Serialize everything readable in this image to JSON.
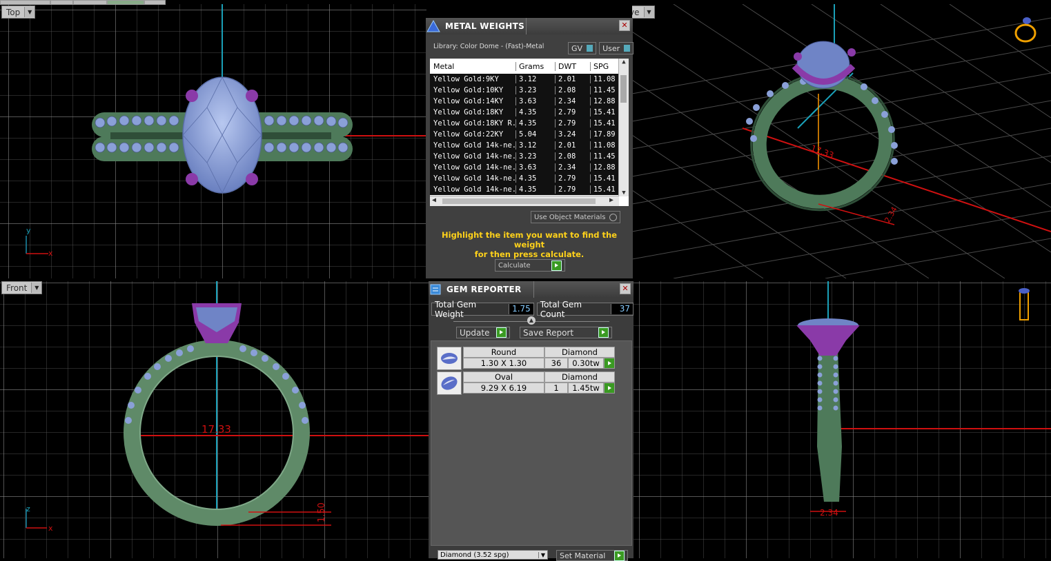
{
  "viewports": {
    "top": {
      "label": "Top"
    },
    "perspective": {
      "label": "Perspective"
    },
    "front": {
      "label": "Front"
    },
    "right": {
      "label": ""
    }
  },
  "dimensions": {
    "ring_diameter_top_persp": "17.33",
    "ring_diameter_front": "17.33",
    "persp_small": "2.34",
    "front_height": "1.50",
    "side_width": "2.34"
  },
  "axes": {
    "y": "y",
    "x": "x",
    "z": "z"
  },
  "metal_weights": {
    "title": "METAL WEIGHTS",
    "library": "Library: Color Dome - (Fast)-Metal",
    "gv_label": "GV",
    "user_label": "User",
    "columns": [
      "Metal",
      "Grams",
      "DWT",
      "SPG"
    ],
    "rows": [
      [
        "Yellow Gold:9KY",
        "3.12",
        "2.01",
        "11.08"
      ],
      [
        "Yellow Gold:10KY",
        "3.23",
        "2.08",
        "11.45"
      ],
      [
        "Yellow Gold:14KY",
        "3.63",
        "2.34",
        "12.88"
      ],
      [
        "Yellow Gold:18KY",
        "4.35",
        "2.79",
        "15.41"
      ],
      [
        "Yellow Gold:18KY R...",
        "4.35",
        "2.79",
        "15.41"
      ],
      [
        "Yellow Gold:22KY",
        "5.04",
        "3.24",
        "17.89"
      ],
      [
        "Yellow Gold 14k-ne...",
        "3.12",
        "2.01",
        "11.08"
      ],
      [
        "Yellow Gold 14k-ne...",
        "3.23",
        "2.08",
        "11.45"
      ],
      [
        "Yellow Gold 14k-ne...",
        "3.63",
        "2.34",
        "12.88"
      ],
      [
        "Yellow Gold 14k-ne...",
        "4.35",
        "2.79",
        "15.41"
      ],
      [
        "Yellow Gold 14k-ne...",
        "4.35",
        "2.79",
        "15.41"
      ]
    ],
    "use_object_materials": "Use Object Materials",
    "hint_line1": "Highlight the item you want to find the weight",
    "hint_line2": "for then press calculate.",
    "calculate": "Calculate"
  },
  "gem_reporter": {
    "title": "GEM REPORTER",
    "total_weight_label": "Total Gem Weight",
    "total_weight_value": "1.75",
    "total_count_label": "Total Gem Count",
    "total_count_value": "37",
    "update": "Update",
    "save_report": "Save Report",
    "gems": [
      {
        "shape": "Round",
        "material": "Diamond",
        "size": "1.30 X 1.30",
        "count": "36",
        "tw": "0.30tw"
      },
      {
        "shape": "Oval",
        "material": "Diamond",
        "size": "9.29 X 6.19",
        "count": "1",
        "tw": "1.45tw"
      }
    ],
    "material_select": "Diamond  (3.52 spg)",
    "set_material": "Set Material"
  },
  "colors": {
    "ring_green": "#4e7a5a",
    "gem_blue": "#8aa0d8",
    "prong_purple": "#8a3aa8",
    "grid": "#5a5a5a",
    "dim_red": "#d01010",
    "axis_cyan": "#1aa0b8",
    "hint_yellow": "#ffd21a"
  }
}
